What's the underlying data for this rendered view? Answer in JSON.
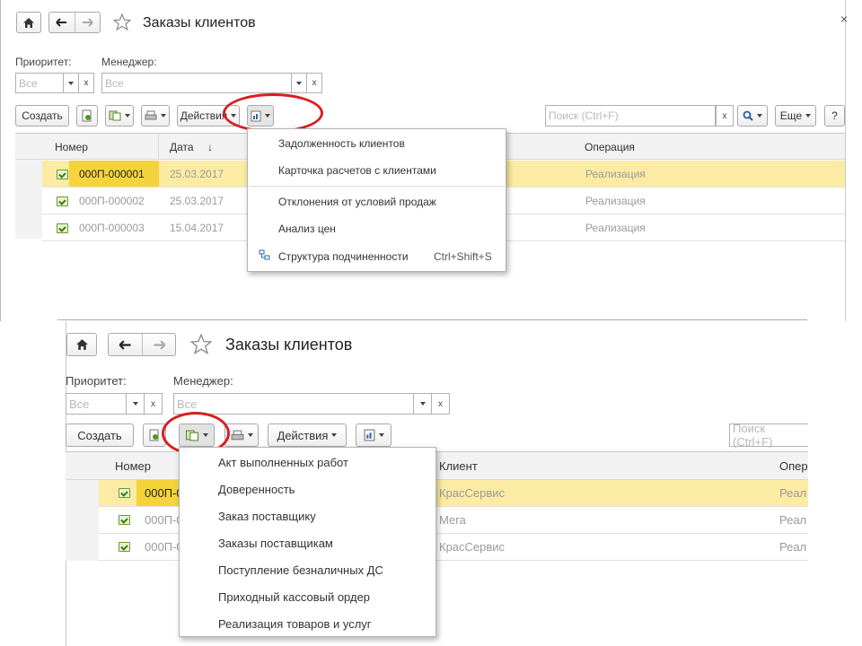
{
  "top": {
    "title": "Заказы клиентов",
    "close_icon": "×",
    "filters": {
      "priority_label": "Приоритет:",
      "priority_value": "Все",
      "manager_label": "Менеджер:",
      "manager_value": "Все"
    },
    "toolbar": {
      "create_label": "Создать",
      "actions_label": "Действия",
      "search_placeholder": "Поиск (Ctrl+F)",
      "more_label": "Еще",
      "help_label": "?"
    },
    "columns": {
      "number": "Номер",
      "date": "Дата",
      "date_sort": "↓",
      "operation": "Операция"
    },
    "rows": [
      {
        "number": "000П-000001",
        "date": "25.03.2017",
        "operation": "Реализация"
      },
      {
        "number": "000П-000002",
        "date": "25.03.2017",
        "operation": "Реализация"
      },
      {
        "number": "000П-000003",
        "date": "15.04.2017",
        "operation": "Реализация"
      }
    ],
    "menu": [
      {
        "label": "Задолженность клиентов"
      },
      {
        "label": "Карточка расчетов с клиентами"
      },
      {
        "label": "Отклонения от условий продаж"
      },
      {
        "label": "Анализ цен"
      },
      {
        "label": "Структура подчиненности",
        "shortcut": "Ctrl+Shift+S"
      }
    ]
  },
  "bottom": {
    "title": "Заказы клиентов",
    "filters": {
      "priority_label": "Приоритет:",
      "priority_value": "Все",
      "manager_label": "Менеджер:",
      "manager_value": "Все"
    },
    "toolbar": {
      "create_label": "Создать",
      "actions_label": "Действия",
      "search_placeholder": "Поиск (Ctrl+F)"
    },
    "columns": {
      "number": "Номер",
      "client": "Клиент",
      "operation": "Опер"
    },
    "rows": [
      {
        "number": "000П-0",
        "client": "КрасСервис",
        "operation": "Реал"
      },
      {
        "number": "000П-0",
        "client": "Мега",
        "operation": "Реал"
      },
      {
        "number": "000П-0",
        "client": "КрасСервис",
        "operation": "Реал"
      }
    ],
    "menu": [
      {
        "label": "Акт выполненных работ"
      },
      {
        "label": "Доверенность"
      },
      {
        "label": "Заказ поставщику"
      },
      {
        "label": "Заказы поставщикам"
      },
      {
        "label": "Поступление безналичных ДС"
      },
      {
        "label": "Приходный кассовый ордер"
      },
      {
        "label": "Реализация товаров и услуг"
      }
    ]
  },
  "icons": {
    "home": "home-icon",
    "back": "arrow-left-icon",
    "forward": "arrow-right-icon",
    "favorite": "star-icon",
    "search": "magnifier-icon",
    "print": "printer-icon",
    "create_based_on": "create-based-on-icon",
    "reports": "reports-icon",
    "structure": "structure-icon",
    "document": "document-posted-icon"
  },
  "colors": {
    "selected_row": "#fbeba3",
    "highlight_oval": "#d81f1f"
  }
}
